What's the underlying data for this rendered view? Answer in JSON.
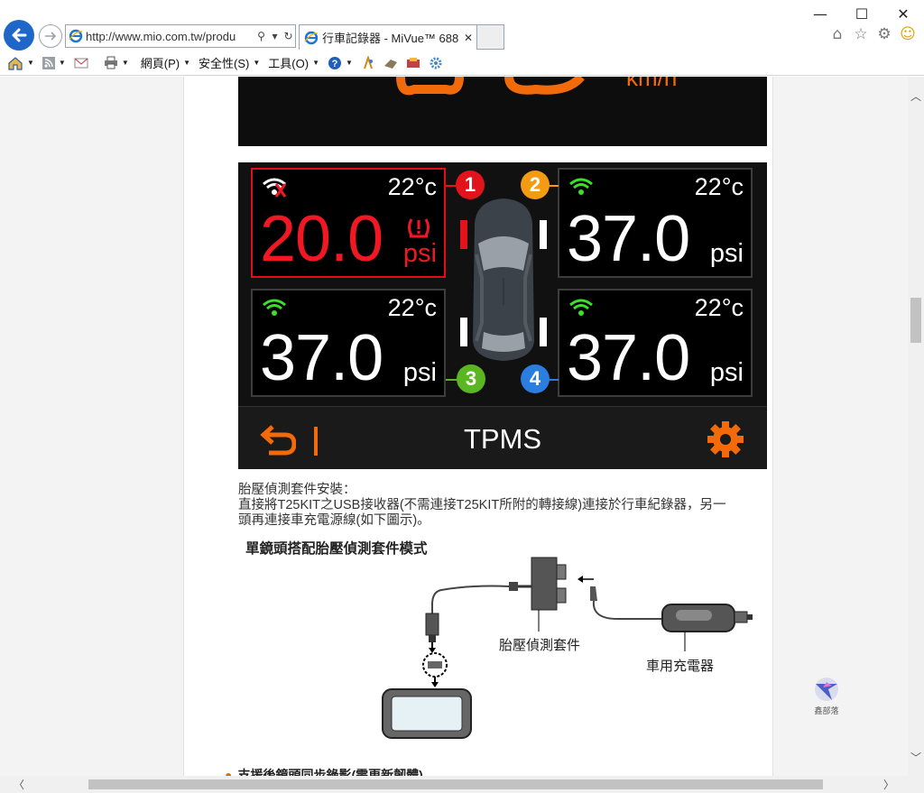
{
  "browser": {
    "url": "http://www.mio.com.tw/produ",
    "tab_title": "行車記錄器 - MiVue™ 688 ...",
    "tab_close": "✕",
    "window": {
      "minimize": "—",
      "maximize": "☐",
      "close": "✕"
    }
  },
  "menubar": {
    "page": "網頁(P)",
    "safety": "安全性(S)",
    "tools": "工具(O)"
  },
  "tpms": {
    "title": "TPMS",
    "tires": [
      {
        "id": "1",
        "temp": "22°c",
        "pressure": "20.0",
        "unit": "psi",
        "alert": true,
        "color": "#e3131c"
      },
      {
        "id": "2",
        "temp": "22°c",
        "pressure": "37.0",
        "unit": "psi",
        "alert": false,
        "color": "#f39c12"
      },
      {
        "id": "3",
        "temp": "22°c",
        "pressure": "37.0",
        "unit": "psi",
        "alert": false,
        "color": "#5ab722"
      },
      {
        "id": "4",
        "temp": "22°c",
        "pressure": "37.0",
        "unit": "psi",
        "alert": false,
        "color": "#2b7de0"
      }
    ],
    "accent": "#f26a0a"
  },
  "content": {
    "heading": "胎壓偵測套件安裝：",
    "line1": "直接將T25KIT之USB接收器(不需連接T25KIT所附的轉接線)連接於行車紀錄器，另一",
    "line2": "頭再連接車充電源線(如下圖示)。",
    "diagram_title": "單鏡頭搭配胎壓偵測套件模式",
    "label_kit": "胎壓偵測套件",
    "label_charger": "車用充電器",
    "watermark": "鑫部落",
    "next_item": "支援後鏡頭同步錄影(需更新韌體)"
  }
}
